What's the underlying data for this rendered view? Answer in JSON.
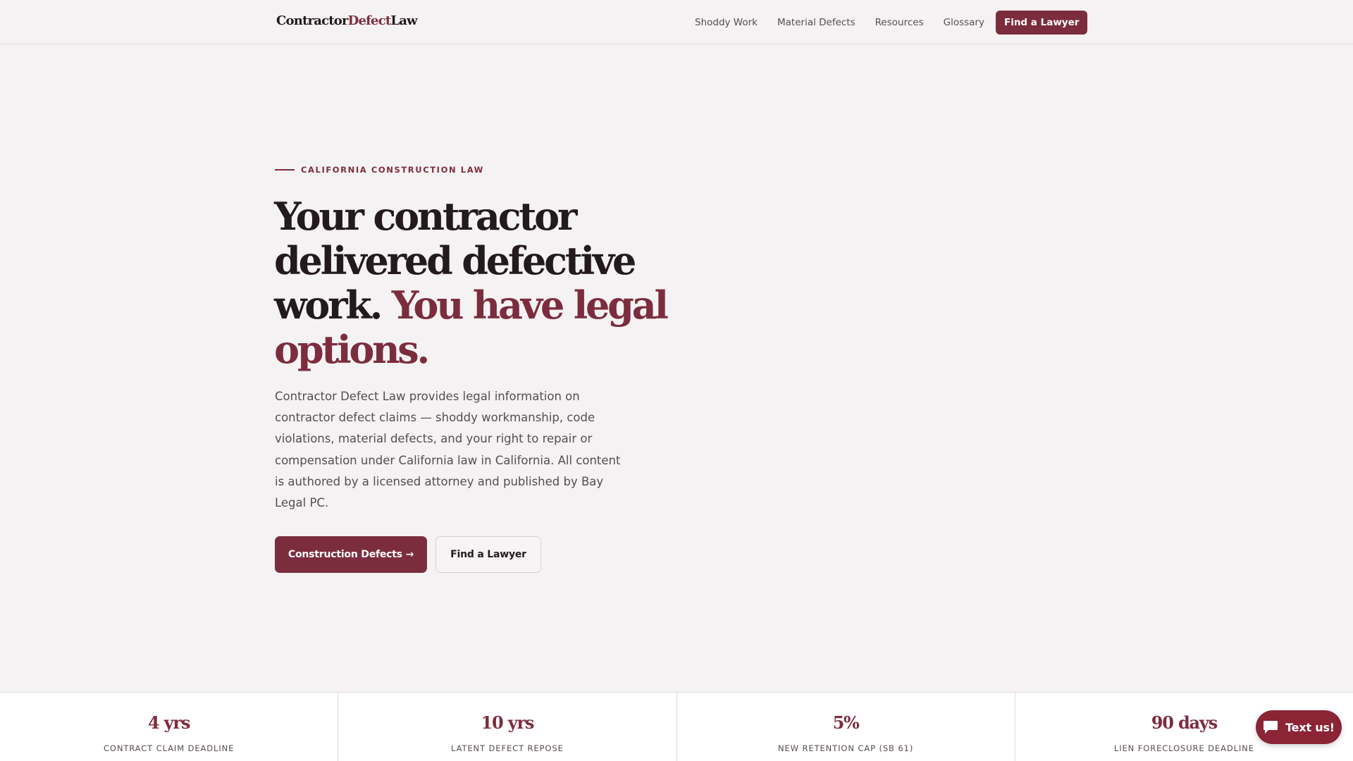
{
  "brand": {
    "part1": "Contractor",
    "part2": "Defect",
    "part3": "Law"
  },
  "nav": {
    "items": [
      {
        "label": "Shoddy Work"
      },
      {
        "label": "Material Defects"
      },
      {
        "label": "Resources"
      },
      {
        "label": "Glossary"
      }
    ],
    "cta_label": "Find a Lawyer"
  },
  "hero": {
    "eyebrow": "CALIFORNIA CONSTRUCTION LAW",
    "headline_main": "Your contractor delivered defective work.",
    "headline_accent": "You have legal options.",
    "lede": "Contractor Defect Law provides legal information on contractor defect claims — shoddy workmanship, code violations, material defects, and your right to repair or compensation under California law in California. All content is authored by a licensed attorney and published by Bay Legal PC.",
    "primary_button": "Construction Defects →",
    "secondary_button": "Find a Lawyer"
  },
  "stats": [
    {
      "value": "4 yrs",
      "label": "CONTRACT CLAIM DEADLINE"
    },
    {
      "value": "10 yrs",
      "label": "LATENT DEFECT REPOSE"
    },
    {
      "value": "5%",
      "label": "NEW RETENTION CAP (SB 61)"
    },
    {
      "value": "90 days",
      "label": "LIEN FORECLOSURE DEADLINE"
    }
  ],
  "chat_widget": {
    "label": "Text us!",
    "icon": "chat-bubble-icon"
  },
  "colors": {
    "accent": "#7c2d3d",
    "background": "#f5f2f3",
    "text": "#231a1c",
    "chat": "#8b2435"
  }
}
